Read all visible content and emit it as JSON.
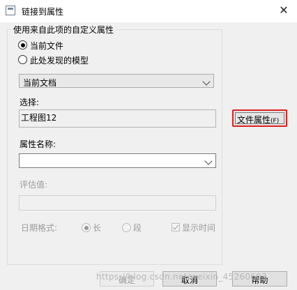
{
  "window": {
    "title": "链接到属性",
    "close_glyph": "✕"
  },
  "group": {
    "label": "使用来自此项的自定义属性",
    "radio_current_file": "当前文件",
    "radio_found_model": "此处发现的模型"
  },
  "doc_select": {
    "value": "当前文档"
  },
  "selection": {
    "label": "选择:",
    "value": "工程图12"
  },
  "file_props_button": {
    "label": "文件属性",
    "shortcut": "(F)"
  },
  "prop_name": {
    "label": "属性名称:",
    "value": ""
  },
  "eval_value": {
    "label": "评估值:",
    "value": ""
  },
  "date_format": {
    "label": "日期格式:",
    "long": "长",
    "short": "段",
    "show_time": "显示时间"
  },
  "buttons": {
    "ok": "确定",
    "cancel": "取消",
    "help": "帮助"
  },
  "watermark": "https://blog.csdn.net/weixin_45260603"
}
